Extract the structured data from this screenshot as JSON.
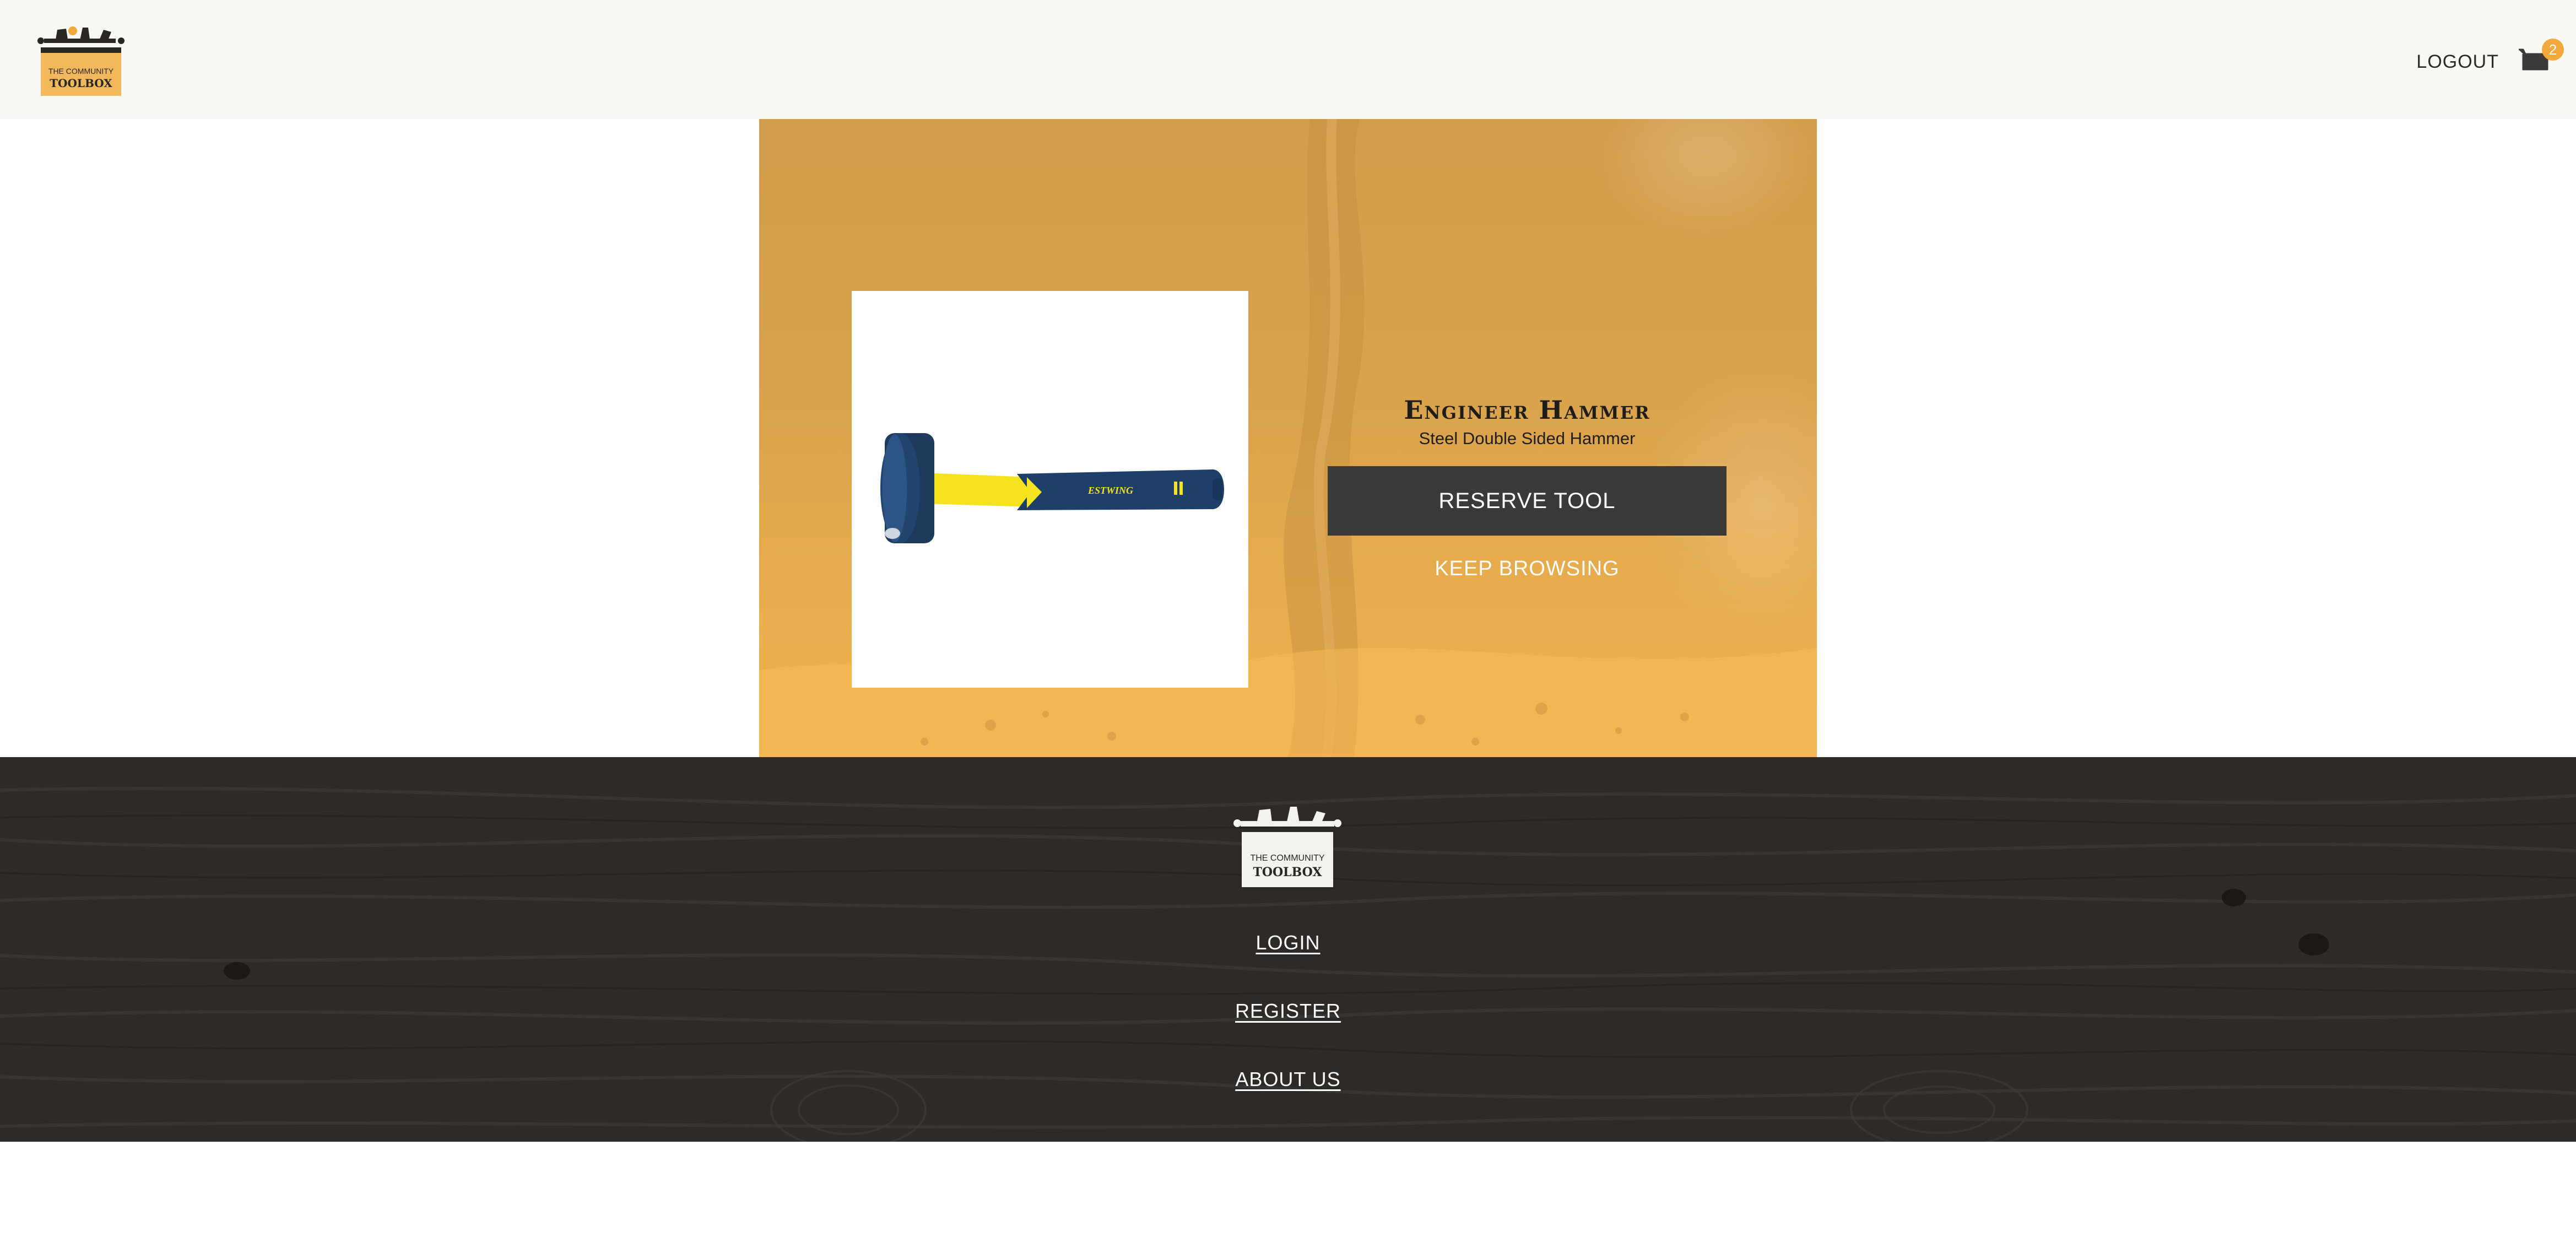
{
  "header": {
    "logo_text_line1": "THE COMMUNITY",
    "logo_text_line2": "TOOLBOX",
    "logout_label": "LOGOUT",
    "cart_count": "2"
  },
  "tool": {
    "name": "Engineer Hammer",
    "description": "Steel Double Sided Hammer",
    "handle_brand": "ESTWING",
    "reserve_label": "RESERVE TOOL",
    "keep_browsing_label": "KEEP BROWSING"
  },
  "footer": {
    "logo_text_line1": "THE COMMUNITY",
    "logo_text_line2": "TOOLBOX",
    "links": [
      {
        "label": "LOGIN"
      },
      {
        "label": "REGISTER"
      },
      {
        "label": "ABOUT US"
      }
    ]
  },
  "colors": {
    "accent": "#f2a93b",
    "hero": "#d9a34c",
    "dark_button": "#3b3a38",
    "footer_wood": "#2d2a27",
    "header_bg": "#f9f8f4"
  },
  "icons": [
    "toolbox-logo-icon",
    "cart-icon",
    "hammer-image"
  ]
}
